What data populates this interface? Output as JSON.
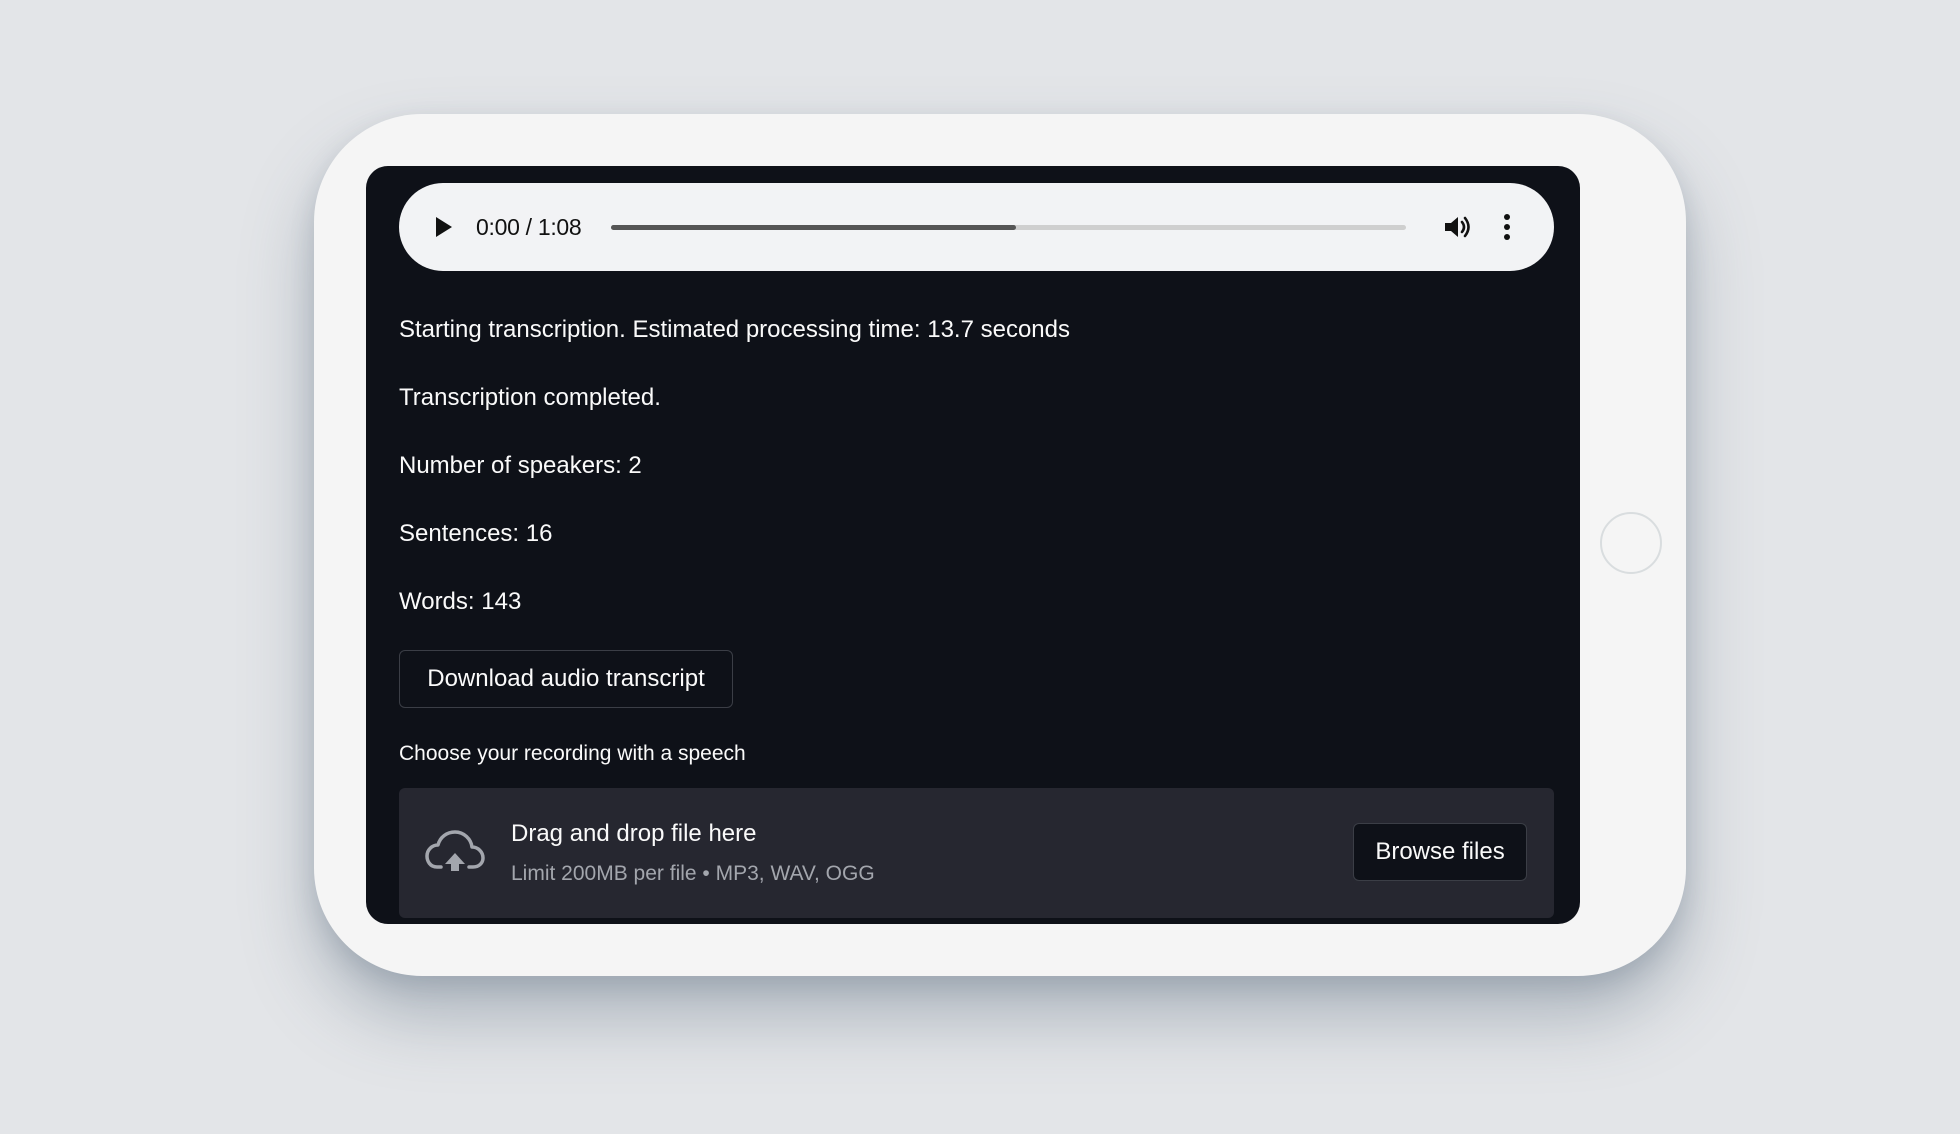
{
  "audio_player": {
    "time": "0:00 / 1:08",
    "progress_fraction": 0.51,
    "icons": {
      "play": "play-icon",
      "volume": "volume-icon",
      "more": "more-vertical-icon"
    }
  },
  "status": {
    "line1": "Starting transcription. Estimated processing time: 13.7 seconds",
    "line2": "Transcription completed.",
    "line3": "Number of speakers: 2",
    "line4": "Sentences: 16",
    "line5": "Words: 143"
  },
  "download_button": {
    "label": "Download audio transcript"
  },
  "uploader": {
    "label": "Choose your recording with a speech",
    "dropzone_title": "Drag and drop file here",
    "dropzone_limit": "Limit 200MB per file • MP3, WAV, OGG",
    "browse_label": "Browse files",
    "icon": "cloud-upload-icon"
  },
  "colors": {
    "screen_background": "#0e1118",
    "dropzone_background": "#262730",
    "text_primary": "#fafafa",
    "text_muted": "#a3a6ad",
    "device_frame": "#f5f5f5"
  }
}
